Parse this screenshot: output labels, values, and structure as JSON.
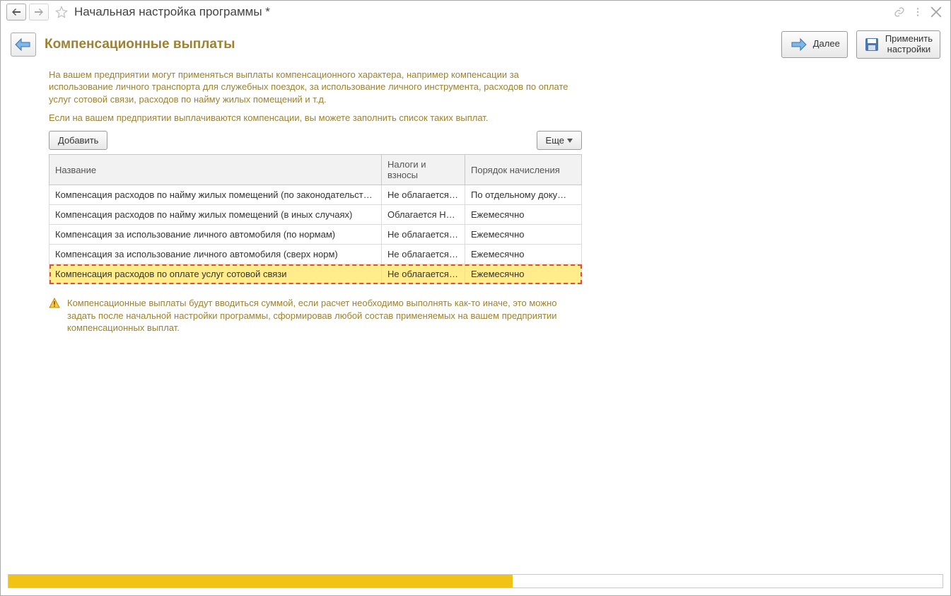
{
  "window_title": "Начальная настройка программы *",
  "heading": "Компенсационные выплаты",
  "buttons": {
    "next": "Далее",
    "apply_line1": "Применить",
    "apply_line2": "настройки",
    "add": "Добавить",
    "more": "Еще"
  },
  "intro": {
    "p1": "На вашем предприятии могут применяться выплаты компенсационного характера, например компенсации за использование личного транспорта для служебных поездок, за использование личного инструмента, расходов по оплате услуг сотовой связи, расходов по найму жилых помещений и т.д.",
    "p2": "Если на вашем предприятии выплачиваются компенсации, вы можете заполнить список таких выплат."
  },
  "table": {
    "headers": {
      "name": "Название",
      "taxes": "Налоги и взносы",
      "order": "Порядок начисления"
    },
    "rows": [
      {
        "name": "Компенсация расходов по найму жилых помещений (по законодательству)",
        "taxes": "Не облагается …",
        "order": "По отдельному доку…",
        "selected": false
      },
      {
        "name": "Компенсация расходов по найму жилых помещений (в иных случаях)",
        "taxes": "Облагается НД…",
        "order": "Ежемесячно",
        "selected": false
      },
      {
        "name": "Компенсация за использование личного автомобиля (по нормам)",
        "taxes": "Не облагается …",
        "order": "Ежемесячно",
        "selected": false
      },
      {
        "name": "Компенсация за использование личного автомобиля (сверх норм)",
        "taxes": "Не облагается …",
        "order": "Ежемесячно",
        "selected": false
      },
      {
        "name": "Компенсация расходов по оплате услуг сотовой связи",
        "taxes": "Не облагается …",
        "order": "Ежемесячно",
        "selected": true
      }
    ]
  },
  "note": "Компенсационные выплаты будут вводиться суммой, если расчет необходимо выполнять как-то иначе, это можно задать после начальной настройки программы, сформировав любой состав применяемых на вашем предприятии компенсационных выплат.",
  "progress_percent": 54
}
